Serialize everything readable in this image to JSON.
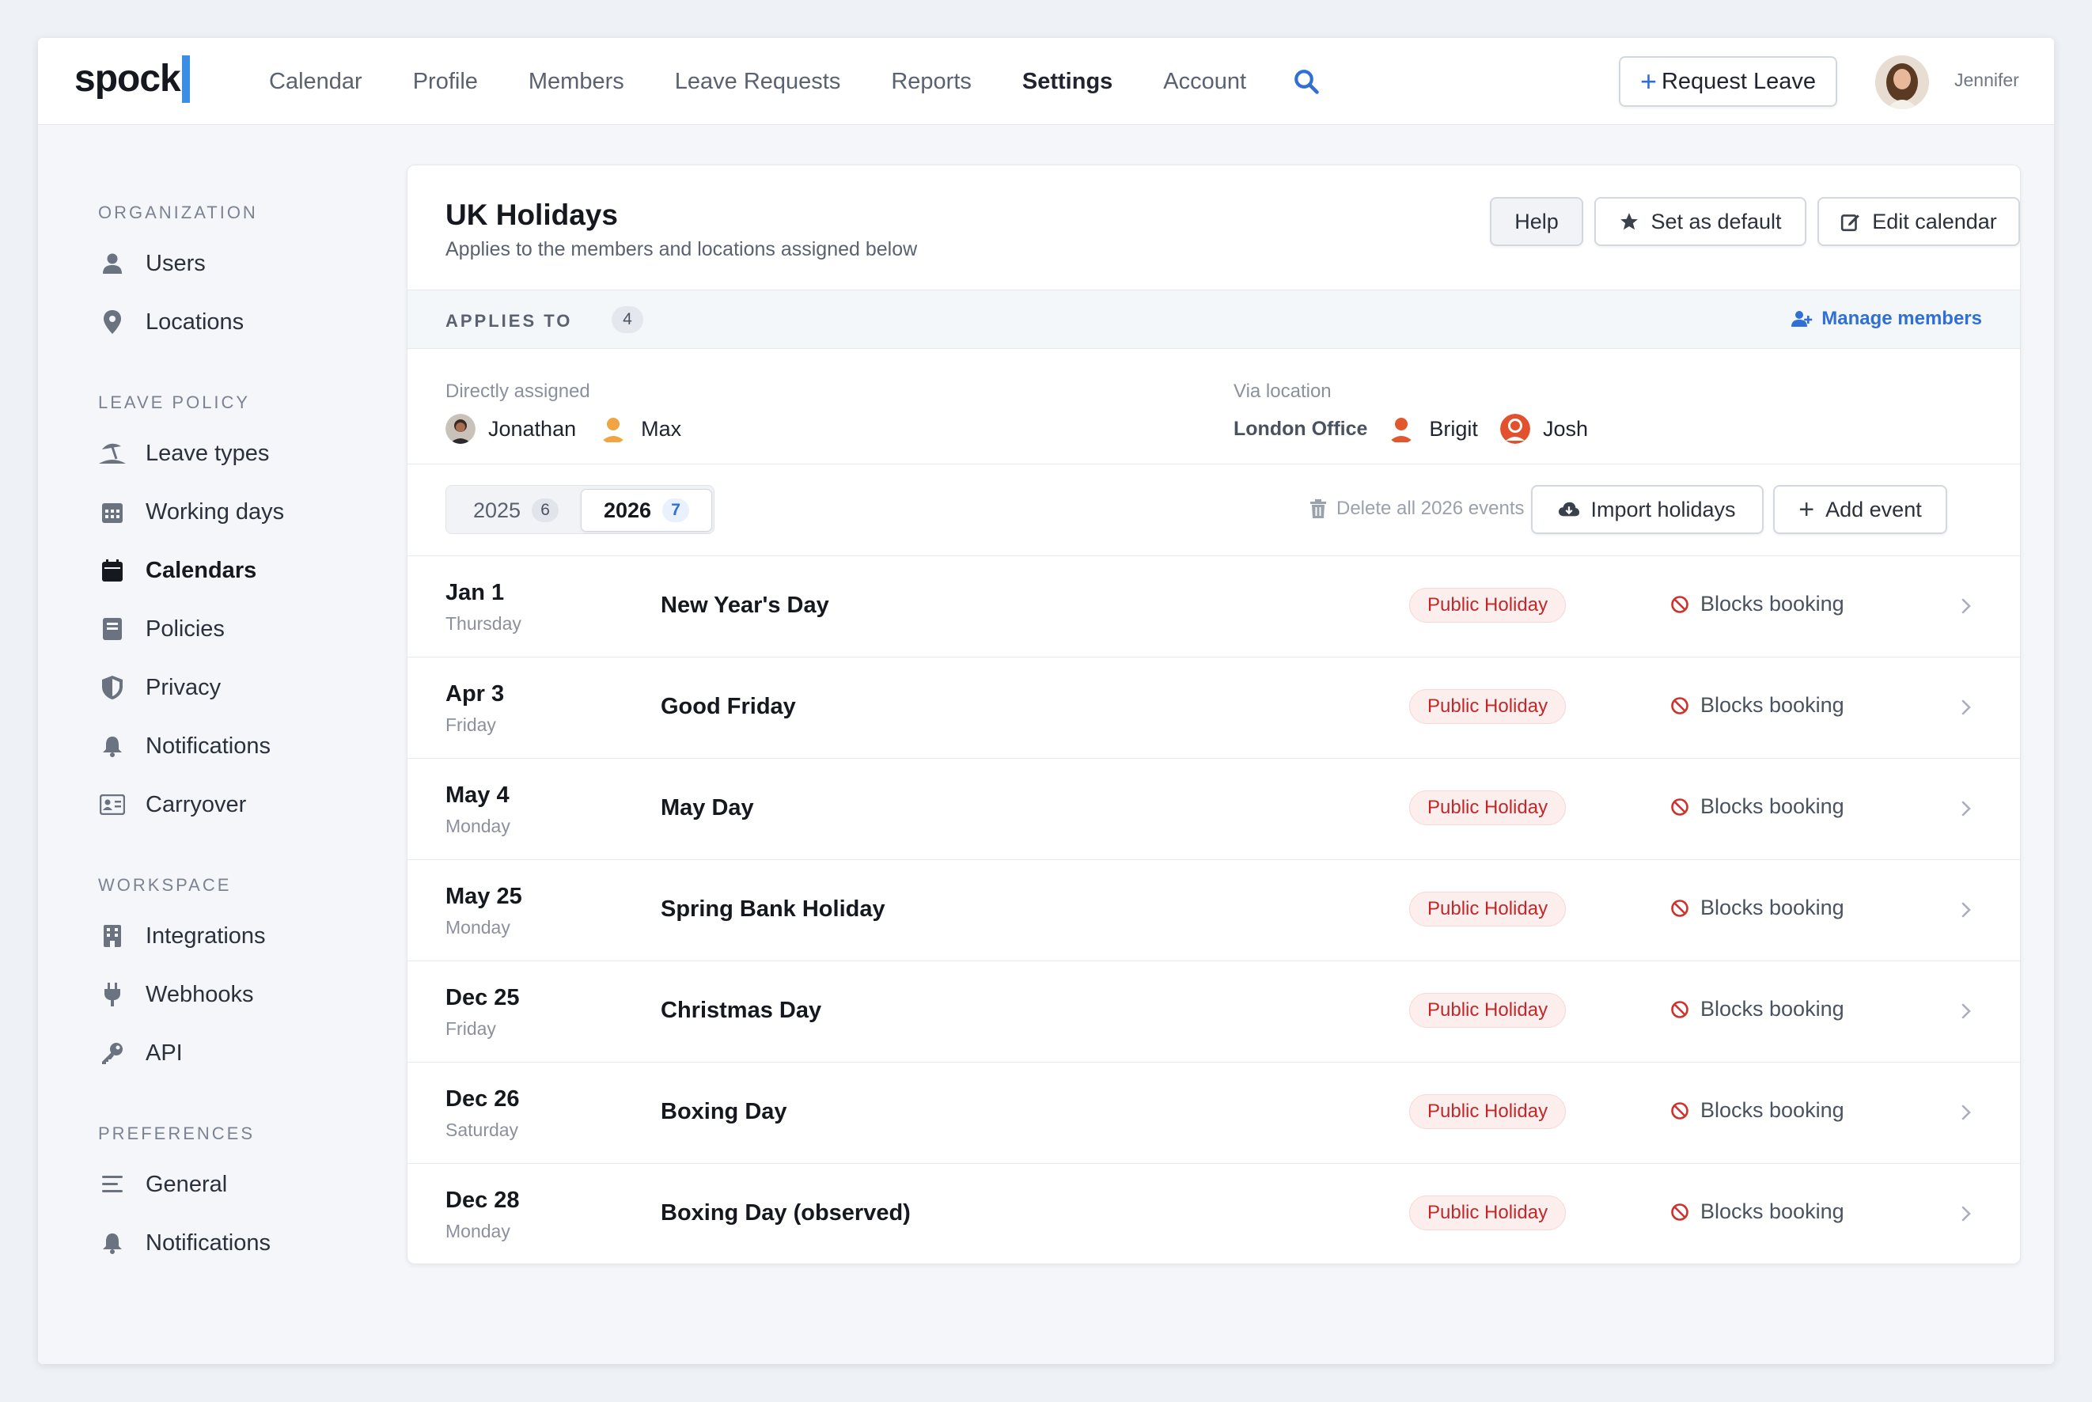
{
  "app": {
    "logo": "spock",
    "brand_color": "#3a8ee6",
    "accent_color": "#2f6fd6"
  },
  "nav": {
    "items": [
      {
        "label": "Calendar"
      },
      {
        "label": "Profile"
      },
      {
        "label": "Members"
      },
      {
        "label": "Leave Requests"
      },
      {
        "label": "Reports"
      },
      {
        "label": "Settings",
        "active": true
      },
      {
        "label": "Account"
      }
    ],
    "search_icon": "search-icon",
    "request_leave_label": "Request Leave",
    "user_name": "Jennifer"
  },
  "sidebar": {
    "sections": [
      {
        "title": "ORGANIZATION",
        "items": [
          {
            "label": "Users",
            "icon": "user-icon"
          },
          {
            "label": "Locations",
            "icon": "map-pin-icon"
          }
        ]
      },
      {
        "title": "LEAVE POLICY",
        "items": [
          {
            "label": "Leave types",
            "icon": "umbrella-beach-icon"
          },
          {
            "label": "Working days",
            "icon": "calendar-grid-icon"
          },
          {
            "label": "Calendars",
            "icon": "calendar-icon",
            "active": true
          },
          {
            "label": "Policies",
            "icon": "book-icon"
          },
          {
            "label": "Privacy",
            "icon": "shield-icon"
          },
          {
            "label": "Notifications",
            "icon": "bell-icon"
          },
          {
            "label": "Carryover",
            "icon": "id-card-icon"
          }
        ]
      },
      {
        "title": "WORKSPACE",
        "items": [
          {
            "label": "Integrations",
            "icon": "building-icon"
          },
          {
            "label": "Webhooks",
            "icon": "plug-icon"
          },
          {
            "label": "API",
            "icon": "key-icon"
          }
        ]
      },
      {
        "title": "PREFERENCES",
        "items": [
          {
            "label": "General",
            "icon": "menu-lines-icon"
          },
          {
            "label": "Notifications",
            "icon": "bell-icon"
          }
        ]
      }
    ]
  },
  "calendar": {
    "title": "UK Holidays",
    "subtitle": "Applies to the members and locations assigned below",
    "help_label": "Help",
    "set_default_label": "Set as default",
    "edit_label": "Edit calendar",
    "applies_to_label": "APPLIES TO",
    "applies_count": "4",
    "manage_members_label": "Manage members",
    "direct_label": "Directly assigned",
    "direct_members": [
      "Jonathan",
      "Max"
    ],
    "via_location_label": "Via location",
    "location_name": "London Office",
    "location_members": [
      "Brigit",
      "Josh"
    ],
    "years": [
      {
        "year": "2025",
        "count": "6"
      },
      {
        "year": "2026",
        "count": "7",
        "selected": true
      }
    ],
    "delete_all_label": "Delete all 2026 events",
    "import_label": "Import holidays",
    "add_event_label": "Add event",
    "events": [
      {
        "date": "Jan 1",
        "weekday": "Thursday",
        "name": "New Year's Day",
        "type": "Public Holiday",
        "rule": "Blocks booking"
      },
      {
        "date": "Apr 3",
        "weekday": "Friday",
        "name": "Good Friday",
        "type": "Public Holiday",
        "rule": "Blocks booking"
      },
      {
        "date": "May 4",
        "weekday": "Monday",
        "name": "May Day",
        "type": "Public Holiday",
        "rule": "Blocks booking"
      },
      {
        "date": "May 25",
        "weekday": "Monday",
        "name": "Spring Bank Holiday",
        "type": "Public Holiday",
        "rule": "Blocks booking"
      },
      {
        "date": "Dec 25",
        "weekday": "Friday",
        "name": "Christmas Day",
        "type": "Public Holiday",
        "rule": "Blocks booking"
      },
      {
        "date": "Dec 26",
        "weekday": "Saturday",
        "name": "Boxing Day",
        "type": "Public Holiday",
        "rule": "Blocks booking"
      },
      {
        "date": "Dec 28",
        "weekday": "Monday",
        "name": "Boxing Day (observed)",
        "type": "Public Holiday",
        "rule": "Blocks booking"
      }
    ]
  }
}
